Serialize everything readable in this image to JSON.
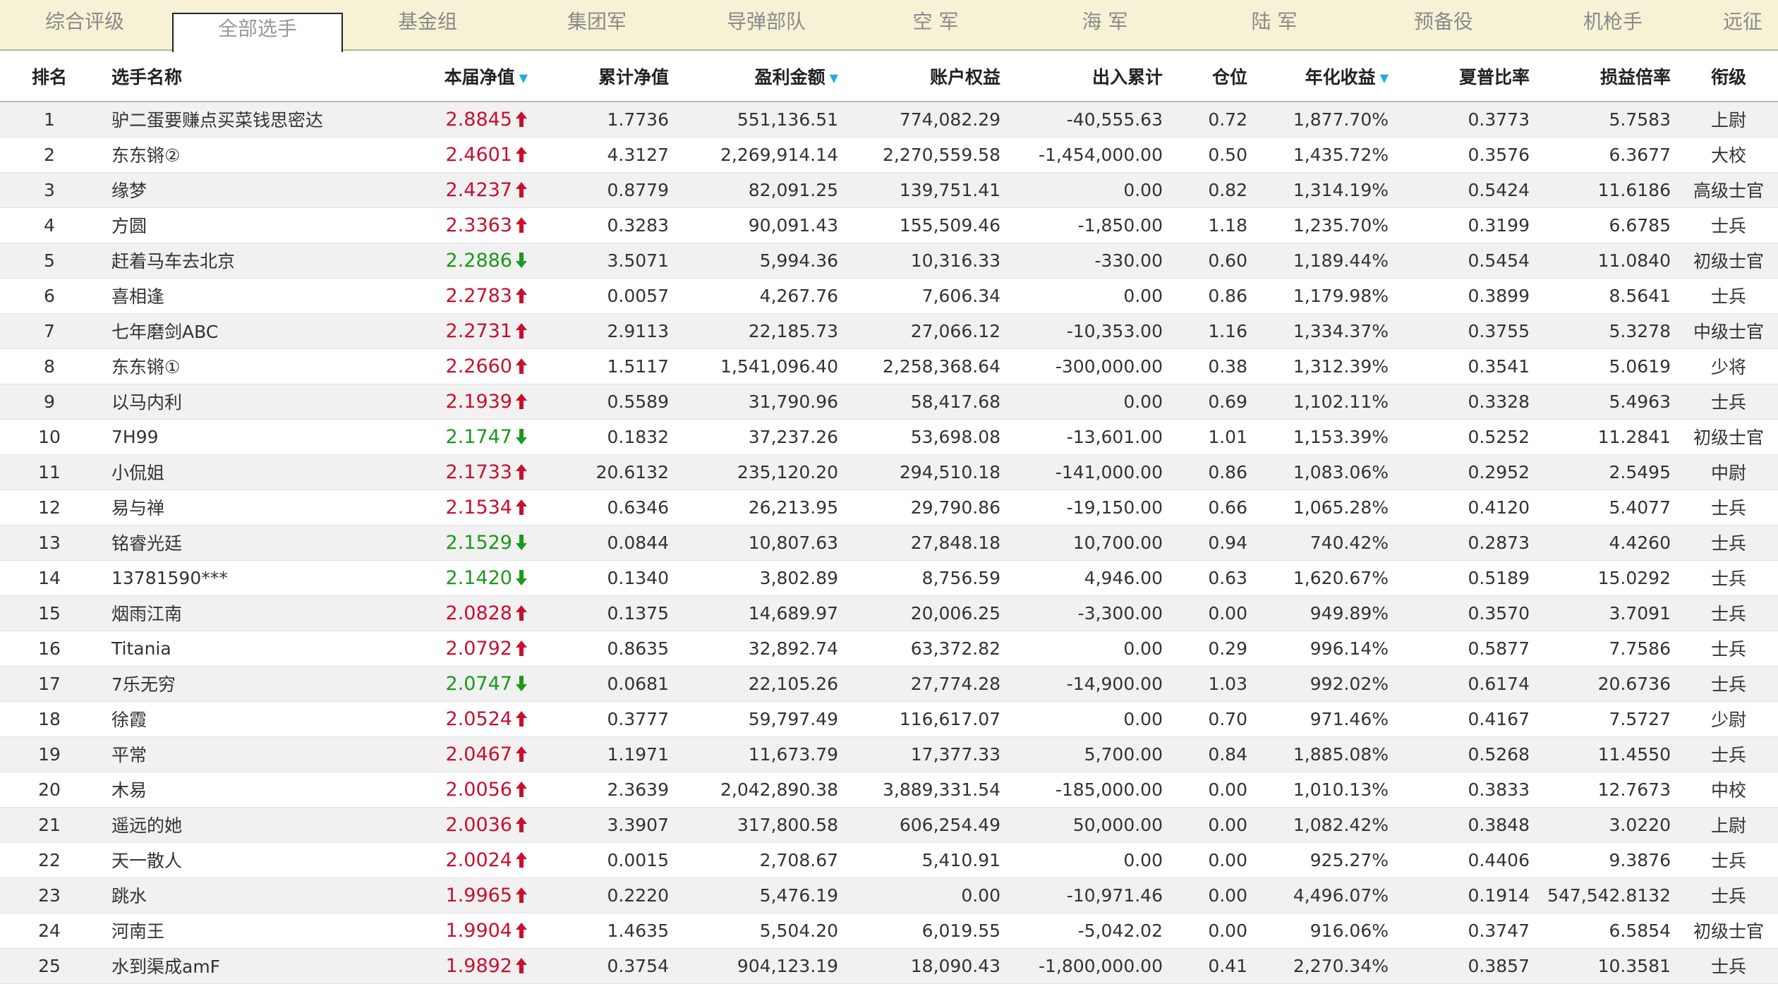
{
  "tabs": [
    {
      "label": "综合评级",
      "active": false
    },
    {
      "label": "全部选手",
      "active": true
    },
    {
      "label": "基金组",
      "active": false
    },
    {
      "label": "集团军",
      "active": false
    },
    {
      "label": "导弹部队",
      "active": false
    },
    {
      "label": "空 军",
      "active": false
    },
    {
      "label": "海 军",
      "active": false
    },
    {
      "label": "陆 军",
      "active": false
    },
    {
      "label": "预备役",
      "active": false
    },
    {
      "label": "机枪手",
      "active": false
    },
    {
      "label": "远征",
      "active": false
    }
  ],
  "columns": [
    {
      "label": "排名",
      "sortable": false
    },
    {
      "label": "选手名称",
      "sortable": false
    },
    {
      "label": "本届净值",
      "sortable": true
    },
    {
      "label": "累计净值",
      "sortable": false
    },
    {
      "label": "盈利金额",
      "sortable": true
    },
    {
      "label": "账户权益",
      "sortable": false
    },
    {
      "label": "出入累计",
      "sortable": false
    },
    {
      "label": "仓位",
      "sortable": false
    },
    {
      "label": "年化收益",
      "sortable": true
    },
    {
      "label": "夏普比率",
      "sortable": false
    },
    {
      "label": "损益倍率",
      "sortable": false
    },
    {
      "label": "衔级",
      "sortable": false
    }
  ],
  "sort_icon": "sort-down-triangle-icon",
  "colors": {
    "up": "#c8102e",
    "down": "#1a9a1a",
    "sort": "#2aa7e0",
    "tab_bg": "#f7f2d6"
  },
  "rows": [
    {
      "rank": "1",
      "name": "驴二蛋要赚点买菜钱思密达",
      "nav": "2.8845",
      "trend": "up",
      "cum_nav": "1.7736",
      "profit": "551,136.51",
      "equity": "774,082.29",
      "inout": "-40,555.63",
      "position": "0.72",
      "annual": "1,877.70%",
      "sharpe": "0.3773",
      "pl_ratio": "5.7583",
      "rank_title": "上尉"
    },
    {
      "rank": "2",
      "name": "东东锵②",
      "nav": "2.4601",
      "trend": "up",
      "cum_nav": "4.3127",
      "profit": "2,269,914.14",
      "equity": "2,270,559.58",
      "inout": "-1,454,000.00",
      "position": "0.50",
      "annual": "1,435.72%",
      "sharpe": "0.3576",
      "pl_ratio": "6.3677",
      "rank_title": "大校"
    },
    {
      "rank": "3",
      "name": "缘梦",
      "nav": "2.4237",
      "trend": "up",
      "cum_nav": "0.8779",
      "profit": "82,091.25",
      "equity": "139,751.41",
      "inout": "0.00",
      "position": "0.82",
      "annual": "1,314.19%",
      "sharpe": "0.5424",
      "pl_ratio": "11.6186",
      "rank_title": "高级士官"
    },
    {
      "rank": "4",
      "name": "方圆",
      "nav": "2.3363",
      "trend": "up",
      "cum_nav": "0.3283",
      "profit": "90,091.43",
      "equity": "155,509.46",
      "inout": "-1,850.00",
      "position": "1.18",
      "annual": "1,235.70%",
      "sharpe": "0.3199",
      "pl_ratio": "6.6785",
      "rank_title": "士兵"
    },
    {
      "rank": "5",
      "name": "赶着马车去北京",
      "nav": "2.2886",
      "trend": "down",
      "cum_nav": "3.5071",
      "profit": "5,994.36",
      "equity": "10,316.33",
      "inout": "-330.00",
      "position": "0.60",
      "annual": "1,189.44%",
      "sharpe": "0.5454",
      "pl_ratio": "11.0840",
      "rank_title": "初级士官"
    },
    {
      "rank": "6",
      "name": "喜相逢",
      "nav": "2.2783",
      "trend": "up",
      "cum_nav": "0.0057",
      "profit": "4,267.76",
      "equity": "7,606.34",
      "inout": "0.00",
      "position": "0.86",
      "annual": "1,179.98%",
      "sharpe": "0.3899",
      "pl_ratio": "8.5641",
      "rank_title": "士兵"
    },
    {
      "rank": "7",
      "name": "七年磨剑ABC",
      "nav": "2.2731",
      "trend": "up",
      "cum_nav": "2.9113",
      "profit": "22,185.73",
      "equity": "27,066.12",
      "inout": "-10,353.00",
      "position": "1.16",
      "annual": "1,334.37%",
      "sharpe": "0.3755",
      "pl_ratio": "5.3278",
      "rank_title": "中级士官"
    },
    {
      "rank": "8",
      "name": "东东锵①",
      "nav": "2.2660",
      "trend": "up",
      "cum_nav": "1.5117",
      "profit": "1,541,096.40",
      "equity": "2,258,368.64",
      "inout": "-300,000.00",
      "position": "0.38",
      "annual": "1,312.39%",
      "sharpe": "0.3541",
      "pl_ratio": "5.0619",
      "rank_title": "少将"
    },
    {
      "rank": "9",
      "name": "以马内利",
      "nav": "2.1939",
      "trend": "up",
      "cum_nav": "0.5589",
      "profit": "31,790.96",
      "equity": "58,417.68",
      "inout": "0.00",
      "position": "0.69",
      "annual": "1,102.11%",
      "sharpe": "0.3328",
      "pl_ratio": "5.4963",
      "rank_title": "士兵"
    },
    {
      "rank": "10",
      "name": "7H99",
      "nav": "2.1747",
      "trend": "down",
      "cum_nav": "0.1832",
      "profit": "37,237.26",
      "equity": "53,698.08",
      "inout": "-13,601.00",
      "position": "1.01",
      "annual": "1,153.39%",
      "sharpe": "0.5252",
      "pl_ratio": "11.2841",
      "rank_title": "初级士官"
    },
    {
      "rank": "11",
      "name": "小侃姐",
      "nav": "2.1733",
      "trend": "up",
      "cum_nav": "20.6132",
      "profit": "235,120.20",
      "equity": "294,510.18",
      "inout": "-141,000.00",
      "position": "0.86",
      "annual": "1,083.06%",
      "sharpe": "0.2952",
      "pl_ratio": "2.5495",
      "rank_title": "中尉"
    },
    {
      "rank": "12",
      "name": "易与禅",
      "nav": "2.1534",
      "trend": "up",
      "cum_nav": "0.6346",
      "profit": "26,213.95",
      "equity": "29,790.86",
      "inout": "-19,150.00",
      "position": "0.66",
      "annual": "1,065.28%",
      "sharpe": "0.4120",
      "pl_ratio": "5.4077",
      "rank_title": "士兵"
    },
    {
      "rank": "13",
      "name": "铭睿光廷",
      "nav": "2.1529",
      "trend": "down",
      "cum_nav": "0.0844",
      "profit": "10,807.63",
      "equity": "27,848.18",
      "inout": "10,700.00",
      "position": "0.94",
      "annual": "740.42%",
      "sharpe": "0.2873",
      "pl_ratio": "4.4260",
      "rank_title": "士兵"
    },
    {
      "rank": "14",
      "name": "13781590***",
      "nav": "2.1420",
      "trend": "down",
      "cum_nav": "0.1340",
      "profit": "3,802.89",
      "equity": "8,756.59",
      "inout": "4,946.00",
      "position": "0.63",
      "annual": "1,620.67%",
      "sharpe": "0.5189",
      "pl_ratio": "15.0292",
      "rank_title": "士兵"
    },
    {
      "rank": "15",
      "name": "烟雨江南",
      "nav": "2.0828",
      "trend": "up",
      "cum_nav": "0.1375",
      "profit": "14,689.97",
      "equity": "20,006.25",
      "inout": "-3,300.00",
      "position": "0.00",
      "annual": "949.89%",
      "sharpe": "0.3570",
      "pl_ratio": "3.7091",
      "rank_title": "士兵"
    },
    {
      "rank": "16",
      "name": "Titania",
      "nav": "2.0792",
      "trend": "up",
      "cum_nav": "0.8635",
      "profit": "32,892.74",
      "equity": "63,372.82",
      "inout": "0.00",
      "position": "0.29",
      "annual": "996.14%",
      "sharpe": "0.5877",
      "pl_ratio": "7.7586",
      "rank_title": "士兵"
    },
    {
      "rank": "17",
      "name": "7乐无穷",
      "nav": "2.0747",
      "trend": "down",
      "cum_nav": "0.0681",
      "profit": "22,105.26",
      "equity": "27,774.28",
      "inout": "-14,900.00",
      "position": "1.03",
      "annual": "992.02%",
      "sharpe": "0.6174",
      "pl_ratio": "20.6736",
      "rank_title": "士兵"
    },
    {
      "rank": "18",
      "name": "徐霞",
      "nav": "2.0524",
      "trend": "up",
      "cum_nav": "0.3777",
      "profit": "59,797.49",
      "equity": "116,617.07",
      "inout": "0.00",
      "position": "0.70",
      "annual": "971.46%",
      "sharpe": "0.4167",
      "pl_ratio": "7.5727",
      "rank_title": "少尉"
    },
    {
      "rank": "19",
      "name": "平常",
      "nav": "2.0467",
      "trend": "up",
      "cum_nav": "1.1971",
      "profit": "11,673.79",
      "equity": "17,377.33",
      "inout": "5,700.00",
      "position": "0.84",
      "annual": "1,885.08%",
      "sharpe": "0.5268",
      "pl_ratio": "11.4550",
      "rank_title": "士兵"
    },
    {
      "rank": "20",
      "name": "木易",
      "nav": "2.0056",
      "trend": "up",
      "cum_nav": "2.3639",
      "profit": "2,042,890.38",
      "equity": "3,889,331.54",
      "inout": "-185,000.00",
      "position": "0.00",
      "annual": "1,010.13%",
      "sharpe": "0.3833",
      "pl_ratio": "12.7673",
      "rank_title": "中校"
    },
    {
      "rank": "21",
      "name": "遥远的她",
      "nav": "2.0036",
      "trend": "up",
      "cum_nav": "3.3907",
      "profit": "317,800.58",
      "equity": "606,254.49",
      "inout": "50,000.00",
      "position": "0.00",
      "annual": "1,082.42%",
      "sharpe": "0.3848",
      "pl_ratio": "3.0220",
      "rank_title": "上尉"
    },
    {
      "rank": "22",
      "name": "天一散人",
      "nav": "2.0024",
      "trend": "up",
      "cum_nav": "0.0015",
      "profit": "2,708.67",
      "equity": "5,410.91",
      "inout": "0.00",
      "position": "0.00",
      "annual": "925.27%",
      "sharpe": "0.4406",
      "pl_ratio": "9.3876",
      "rank_title": "士兵"
    },
    {
      "rank": "23",
      "name": "跳水",
      "nav": "1.9965",
      "trend": "up",
      "cum_nav": "0.2220",
      "profit": "5,476.19",
      "equity": "0.00",
      "inout": "-10,971.46",
      "position": "0.00",
      "annual": "4,496.07%",
      "sharpe": "0.1914",
      "pl_ratio": "547,542.8132",
      "rank_title": "士兵"
    },
    {
      "rank": "24",
      "name": "河南王",
      "nav": "1.9904",
      "trend": "up",
      "cum_nav": "1.4635",
      "profit": "5,504.20",
      "equity": "6,019.55",
      "inout": "-5,042.02",
      "position": "0.00",
      "annual": "916.06%",
      "sharpe": "0.3747",
      "pl_ratio": "6.5854",
      "rank_title": "初级士官"
    },
    {
      "rank": "25",
      "name": "水到渠成amF",
      "nav": "1.9892",
      "trend": "up",
      "cum_nav": "0.3754",
      "profit": "904,123.19",
      "equity": "18,090.43",
      "inout": "-1,800,000.00",
      "position": "0.41",
      "annual": "2,270.34%",
      "sharpe": "0.3857",
      "pl_ratio": "10.3581",
      "rank_title": "士兵"
    }
  ]
}
